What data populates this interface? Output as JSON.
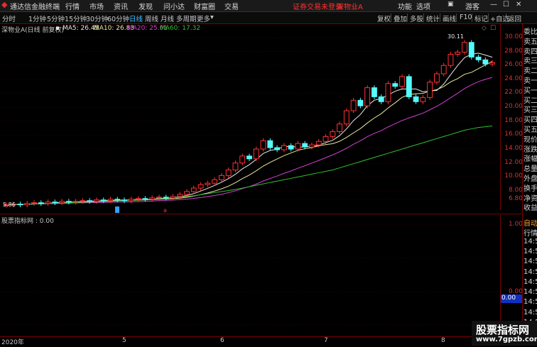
{
  "titlebar": {
    "app_name": "通达信金融终端",
    "menus": [
      "行情",
      "市场",
      "资讯",
      "发现",
      "问小达",
      "财富圈",
      "交易"
    ],
    "notice": "证券交易未登录",
    "stock": "深物业A",
    "right_menus": [
      "功能",
      "选项"
    ],
    "guest": "游客"
  },
  "toolbar": {
    "periods": [
      "分时",
      "1分钟",
      "5分钟",
      "15分钟",
      "30分钟",
      "60分钟",
      "日线",
      "周线",
      "月线",
      "多周期",
      "更多"
    ],
    "active_period": "日线",
    "more_arrow": "▾",
    "actions": [
      "复权",
      "叠加",
      "多股",
      "统计",
      "画线",
      "F10",
      "标记",
      "+自选",
      "返回"
    ]
  },
  "main_legend": {
    "title": "深物业A(日线 前复权)",
    "ma5": "MA5: 26.45",
    "ma10": "MA10: 26.83",
    "ma20": "MA20: 25.01",
    "ma60": "MA60: 17.32",
    "ma5_color": "#e8e8e8",
    "ma10_color": "#e8e8a0",
    "ma20_color": "#d040d0",
    "ma60_color": "#30c030"
  },
  "price_axis": [
    "30.00",
    "28.00",
    "26.00",
    "24.00",
    "22.00",
    "20.00",
    "18.00",
    "16.00",
    "14.00",
    "12.00",
    "10.00",
    "8.00",
    "6.80"
  ],
  "annotations": {
    "high": "30.11",
    "low": "5.86",
    "marker_a": "a"
  },
  "sub_legend": {
    "title": "股票指标网 : 0.00"
  },
  "sub_axis": [
    "1.00",
    "0.00"
  ],
  "sub_value_box": "0.00",
  "right_panel": [
    "委比",
    "卖五",
    "卖四",
    "卖三",
    "卖二",
    "卖一",
    "买一",
    "买二",
    "买三",
    "买四",
    "买五",
    "现价",
    "涨跌",
    "涨幅",
    "总量",
    "外盘",
    "换手",
    "净资",
    "收益",
    "自动",
    "行情",
    "14:5",
    "14:5",
    "14:5",
    "14:5",
    "14:5",
    "14:5",
    "14:5",
    "14:5",
    "14:5",
    "14:5",
    "14:5"
  ],
  "x_axis": {
    "year": "2020年",
    "labels": [
      "5",
      "6",
      "7",
      "8"
    ]
  },
  "watermark": {
    "line1": "股票指标网",
    "line2": "www.7gpzb.com"
  },
  "chart_data": {
    "type": "candlestick",
    "description_series": [
      {
        "name": "MA5",
        "color": "#e8e8e8"
      },
      {
        "name": "MA10",
        "color": "#e8e8a0"
      },
      {
        "name": "MA20",
        "color": "#d040d0"
      },
      {
        "name": "MA60",
        "color": "#30c030"
      }
    ],
    "ylim": [
      5.86,
      30.5
    ],
    "close": [
      6.0,
      6.1,
      6.0,
      6.2,
      6.3,
      6.2,
      6.4,
      6.3,
      6.5,
      6.4,
      6.5,
      6.6,
      6.5,
      6.7,
      6.6,
      6.8,
      6.7,
      6.6,
      6.8,
      6.9,
      6.8,
      7.0,
      7.1,
      7.0,
      7.2,
      7.5,
      7.9,
      8.4,
      8.9,
      9.1,
      9.6,
      10.2,
      11.0,
      12.0,
      13.0,
      12.6,
      14.0,
      15.2,
      14.2,
      13.9,
      14.5,
      14.0,
      14.8,
      14.3,
      14.6,
      15.1,
      15.8,
      16.5,
      17.6,
      19.5,
      21.0,
      20.2,
      22.8,
      21.5,
      20.8,
      23.4,
      23.0,
      24.4,
      21.5,
      20.8,
      21.4,
      23.6,
      24.8,
      26.0,
      27.6,
      27.9,
      29.3,
      27.2,
      26.8,
      26.2,
      26.4
    ],
    "open": [
      5.95,
      6.0,
      6.1,
      6.0,
      6.2,
      6.3,
      6.2,
      6.4,
      6.3,
      6.5,
      6.4,
      6.5,
      6.6,
      6.5,
      6.7,
      6.6,
      6.8,
      6.7,
      6.6,
      6.8,
      6.9,
      6.8,
      7.0,
      7.1,
      7.0,
      7.2,
      7.5,
      7.9,
      8.4,
      8.9,
      9.1,
      9.6,
      10.2,
      11.0,
      12.0,
      13.0,
      12.6,
      14.0,
      15.2,
      14.2,
      13.9,
      14.5,
      14.0,
      14.8,
      14.3,
      14.6,
      15.1,
      15.8,
      16.5,
      17.6,
      19.5,
      21.0,
      20.2,
      22.8,
      21.5,
      20.8,
      23.4,
      23.0,
      24.4,
      21.5,
      20.8,
      21.4,
      23.6,
      24.8,
      26.0,
      27.6,
      27.9,
      29.3,
      27.2,
      26.8,
      26.2
    ],
    "ma60": [
      6.0,
      6.0,
      6.05,
      6.1,
      6.1,
      6.15,
      6.2,
      6.2,
      6.25,
      6.3,
      6.3,
      6.35,
      6.4,
      6.45,
      6.5,
      6.5,
      6.55,
      6.6,
      6.65,
      6.7,
      6.75,
      6.8,
      6.85,
      6.9,
      7.0,
      7.1,
      7.2,
      7.3,
      7.45,
      7.6,
      7.75,
      7.9,
      8.05,
      8.2,
      8.4,
      8.6,
      8.8,
      9.0,
      9.2,
      9.4,
      9.6,
      9.8,
      10.0,
      10.2,
      10.4,
      10.6,
      10.8,
      11.0,
      11.3,
      11.6,
      11.9,
      12.2,
      12.5,
      12.8,
      13.1,
      13.4,
      13.7,
      14.0,
      14.3,
      14.6,
      14.9,
      15.2,
      15.5,
      15.8,
      16.1,
      16.4,
      16.7,
      16.9,
      17.1,
      17.2,
      17.32
    ]
  }
}
